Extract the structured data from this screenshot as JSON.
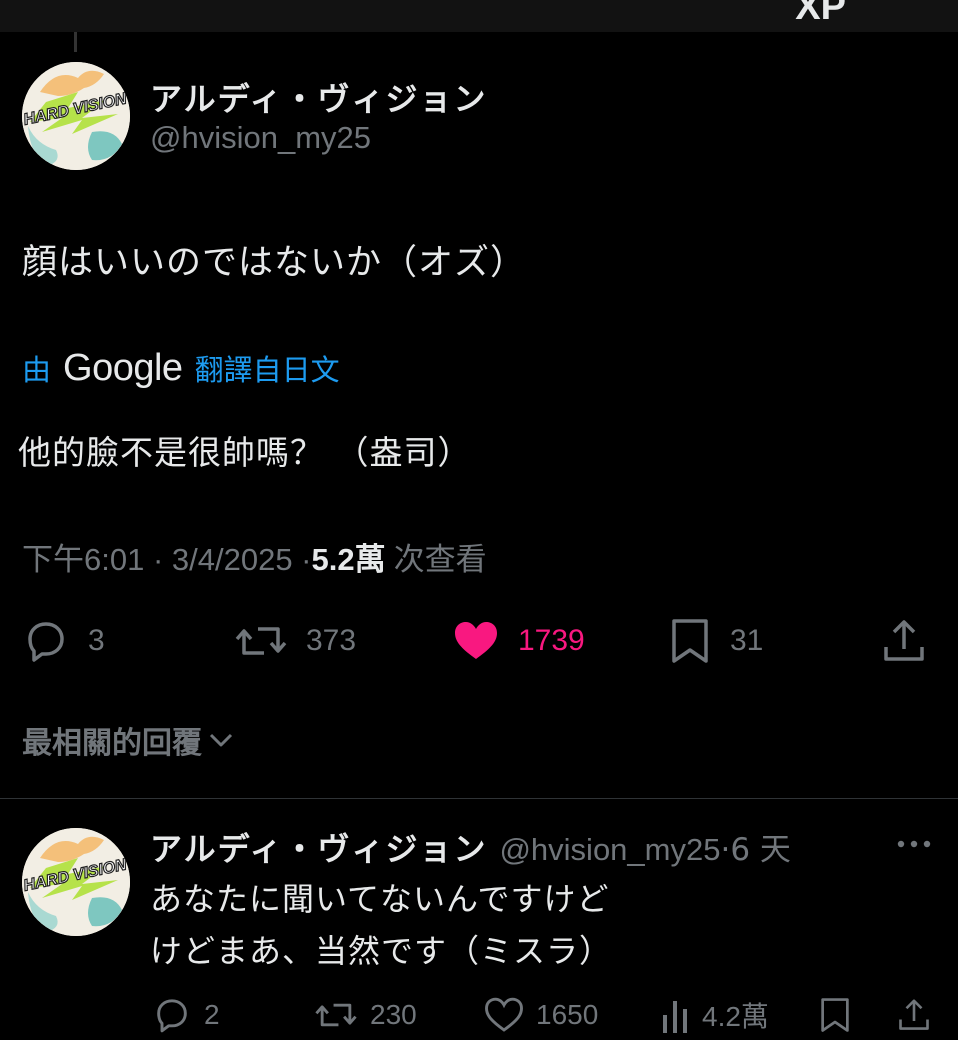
{
  "topbar": {
    "corner_glyph": "XP"
  },
  "tweet": {
    "author_name": "アルディ・ヴィジョン",
    "author_handle": "@hvision_my25",
    "avatar_text": "HARD VISION",
    "text": "顔はいいのではないか（オズ）",
    "translation": {
      "prefix": "由",
      "provider": "Google",
      "suffix": "翻譯自日文",
      "text": "他的臉不是很帥嗎？ （盎司）"
    },
    "time": "下午6:01 · 3/4/2025 · ",
    "views_count": "5.2萬",
    "views_label": "次查看",
    "stats": {
      "replies": "3",
      "reposts": "373",
      "likes": "1739",
      "bookmarks": "31"
    },
    "icons": [
      "reply-icon",
      "repost-icon",
      "like-icon-filled",
      "bookmark-icon",
      "share-icon"
    ],
    "colors": {
      "like": "#f91880",
      "link": "#1d9bf0",
      "muted": "#71767b"
    }
  },
  "replies_section": {
    "sort_label": "最相關的回覆",
    "sort_icon": "chevron-down-icon"
  },
  "reply": {
    "author_name": "アルディ・ヴィジョン",
    "author_handle": "@hvision_my25",
    "time": "·6 天",
    "lines": [
      "あなたに聞いてないんですけど",
      "けどまあ、当然です（ミスラ）"
    ],
    "stats": {
      "replies": "2",
      "reposts": "230",
      "likes": "1650",
      "views": "4.2萬"
    }
  }
}
